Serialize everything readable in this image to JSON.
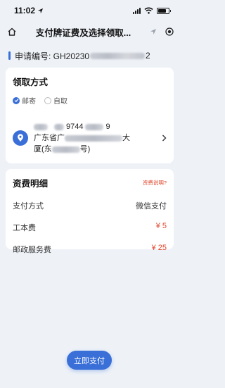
{
  "status": {
    "time": "11:02"
  },
  "nav": {
    "title": "支付牌证费及选择领取..."
  },
  "application": {
    "label": "申请编号: GH20230",
    "tail": "2"
  },
  "delivery": {
    "title": "领取方式",
    "options": [
      {
        "label": "邮寄",
        "checked": true
      },
      {
        "label": "自取",
        "checked": false
      }
    ],
    "address": {
      "phone_fragment": "9744",
      "phone_end": "9",
      "line1_start": "广东省广",
      "line1_end": "大",
      "line2_start": "厦(东",
      "line2_end": "号)"
    }
  },
  "fees": {
    "title": "资费明细",
    "link": "资费说明?",
    "rows": [
      {
        "label": "支付方式",
        "value": "微信支付",
        "highlight": false
      },
      {
        "label": "工本费",
        "value": "¥ 5",
        "highlight": true
      },
      {
        "label": "邮政服务费",
        "value": "¥ 25",
        "highlight": true
      }
    ]
  },
  "actions": {
    "pay": "立即支付"
  },
  "colors": {
    "accent": "#3a6fd8",
    "price": "#e0452b",
    "background": "#eef2f7"
  }
}
